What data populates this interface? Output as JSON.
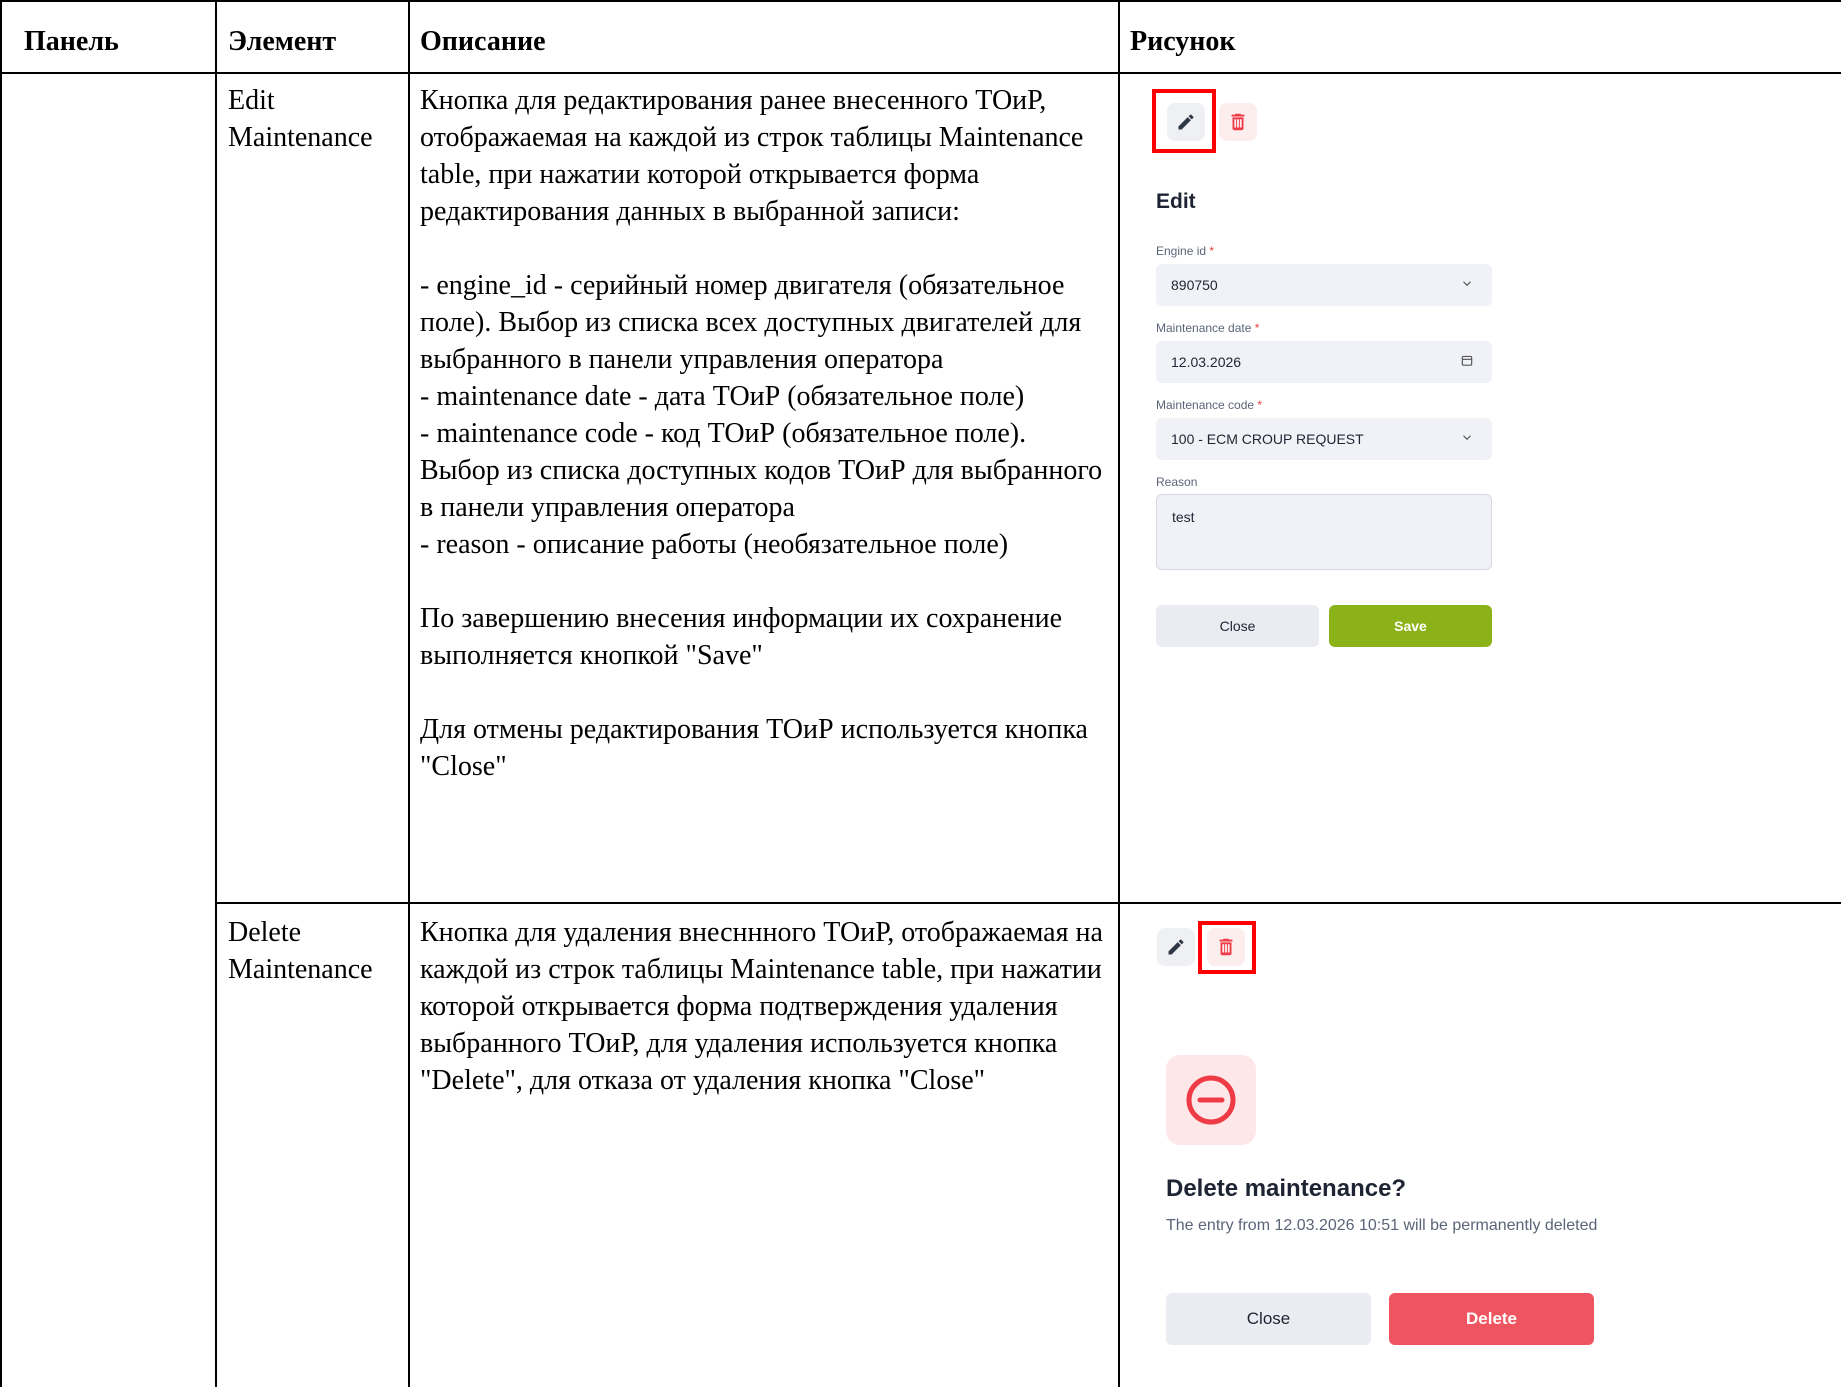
{
  "table": {
    "headers": {
      "panel": "Панель",
      "element": "Элемент",
      "description": "Описание",
      "figure": "Рисунок"
    },
    "rows": [
      {
        "panel": "",
        "element": "Edit\nMaintenance",
        "description": [
          "Кнопка для редактирования ранее внесенного ТОиР, отображаемая на каждой из строк таблицы Maintenance table, при нажатии которой открывается форма редактирования данных в выбранной записи:",
          "- engine_id - серийный номер двигателя (обязательное поле). Выбор из списка всех доступных двигателей для выбранного в панели управления оператора\n- maintenance date - дата ТОиР (обязательное поле)\n- maintenance code - код ТОиР (обязательное поле). Выбор из списка доступных кодов ТОиР для выбранного в панели управления оператора\n- reason - описание работы (необязательное поле)",
          "По завершению внесения информации их сохранение выполняется кнопкой \"Save\"",
          "Для отмены редактирования ТОиР используется кнопка \"Close\""
        ]
      },
      {
        "panel": "",
        "element": "Delete\nMaintenance",
        "description": [
          "Кнопка для удаления внесннного ТОиР, отображаемая на каждой из строк таблицы Maintenance table, при нажатии которой открывается форма подтверждения удаления выбранного ТОиР, для удаления используется кнопка \"Delete\", для отказа от удаления кнопка \"Close\""
        ]
      }
    ]
  },
  "edit_form": {
    "title": "Edit",
    "engine_id_label": "Engine id",
    "engine_id_value": "890750",
    "date_label": "Maintenance date",
    "date_value": "12.03.2026",
    "code_label": "Maintenance code",
    "code_value": "100 - ECM CROUP REQUEST",
    "reason_label": "Reason",
    "reason_value": "test",
    "required_mark": "*",
    "close_label": "Close",
    "save_label": "Save"
  },
  "delete_dialog": {
    "title": "Delete maintenance?",
    "text": "The entry from 12.03.2026 10:51 will be permanently deleted",
    "close_label": "Close",
    "delete_label": "Delete"
  },
  "colors": {
    "highlight": "#ff0000",
    "save": "#8cb21a",
    "delete": "#ee5560"
  },
  "icons": [
    "pencil-icon",
    "trash-icon",
    "chevron-down-icon",
    "calendar-icon",
    "minus-circle-icon"
  ]
}
